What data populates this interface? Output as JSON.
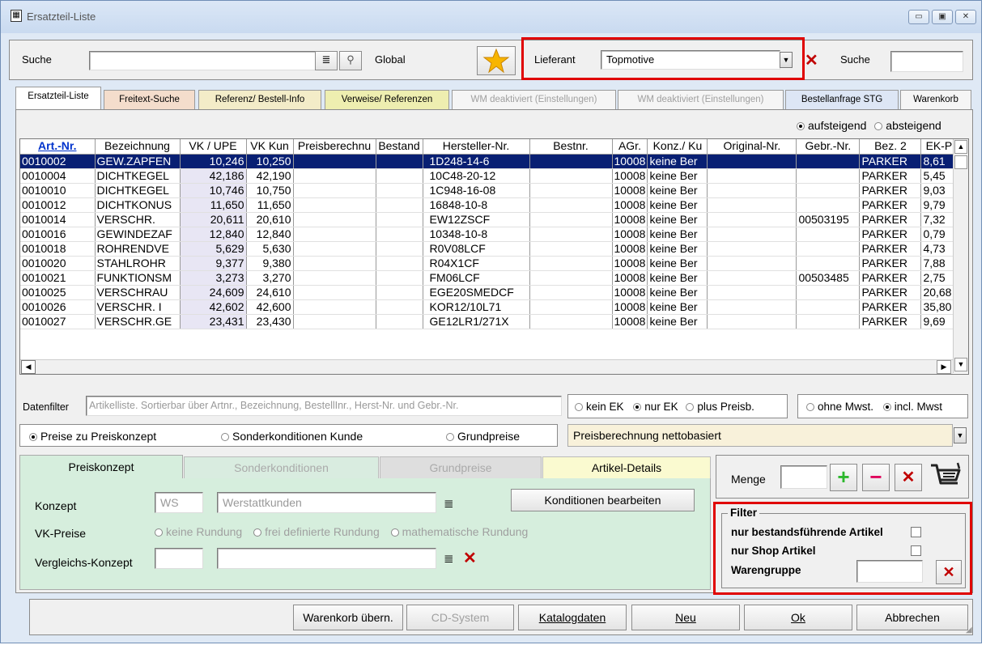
{
  "window": {
    "title": "Ersatzteil-Liste",
    "controls": {
      "minimize": "▭",
      "maximize": "▣",
      "close": "✕"
    }
  },
  "search": {
    "label": "Suche",
    "value": "",
    "scope": "Global",
    "supplier_label": "Lieferant",
    "supplier_value": "Topmotive",
    "search2_label": "Suche",
    "search2_value": ""
  },
  "tabs": [
    {
      "label": "Ersatzteil-Liste"
    },
    {
      "label": "Freitext-Suche"
    },
    {
      "label": "Referenz/ Bestell-Info"
    },
    {
      "label": "Verweise/ Referenzen"
    },
    {
      "label": "WM deaktiviert (Einstellungen)"
    },
    {
      "label": "WM deaktiviert (Einstellungen)"
    },
    {
      "label": "Bestellanfrage STG"
    },
    {
      "label": "Warenkorb"
    }
  ],
  "sort": {
    "asc": "aufsteigend",
    "desc": "absteigend"
  },
  "table": {
    "columns": [
      "Art.-Nr.",
      "Bezeichnung",
      "VK / UPE",
      "VK Kun",
      "Preisberechnu",
      "Bestand",
      "Hersteller-Nr.",
      "Bestnr.",
      "AGr.",
      "Konz./ Ku",
      "Original-Nr.",
      "Gebr.-Nr.",
      "Bez. 2",
      "EK-P"
    ],
    "rows": [
      [
        "0010002",
        "GEW.ZAPFEN",
        "10,246",
        "10,250",
        "",
        "",
        "1D248-14-6",
        "",
        "10008",
        "keine Ber",
        "",
        "",
        "PARKER",
        "8,61"
      ],
      [
        "0010004",
        "DICHTKEGEL",
        "42,186",
        "42,190",
        "",
        "",
        "10C48-20-12",
        "",
        "10008",
        "keine Ber",
        "",
        "",
        "PARKER",
        "5,45"
      ],
      [
        "0010010",
        "DICHTKEGEL",
        "10,746",
        "10,750",
        "",
        "",
        "1C948-16-08",
        "",
        "10008",
        "keine Ber",
        "",
        "",
        "PARKER",
        "9,03"
      ],
      [
        "0010012",
        "DICHTKONUS",
        "11,650",
        "11,650",
        "",
        "",
        "16848-10-8",
        "",
        "10008",
        "keine Ber",
        "",
        "",
        "PARKER",
        "9,79"
      ],
      [
        "0010014",
        "VERSCHR.",
        "20,611",
        "20,610",
        "",
        "",
        "EW12ZSCF",
        "",
        "10008",
        "keine Ber",
        "",
        "00503195",
        "PARKER",
        "7,32"
      ],
      [
        "0010016",
        "GEWINDEZAF",
        "12,840",
        "12,840",
        "",
        "",
        "10348-10-8",
        "",
        "10008",
        "keine Ber",
        "",
        "",
        "PARKER",
        "0,79"
      ],
      [
        "0010018",
        "ROHRENDVE",
        "5,629",
        "5,630",
        "",
        "",
        "R0V08LCF",
        "",
        "10008",
        "keine Ber",
        "",
        "",
        "PARKER",
        "4,73"
      ],
      [
        "0010020",
        "STAHLROHR",
        "9,377",
        "9,380",
        "",
        "",
        "R04X1CF",
        "",
        "10008",
        "keine Ber",
        "",
        "",
        "PARKER",
        "7,88"
      ],
      [
        "0010021",
        "FUNKTIONSM",
        "3,273",
        "3,270",
        "",
        "",
        "FM06LCF",
        "",
        "10008",
        "keine Ber",
        "",
        "00503485",
        "PARKER",
        "2,75"
      ],
      [
        "0010025",
        "VERSCHRAU",
        "24,609",
        "24,610",
        "",
        "",
        "EGE20SMEDCF",
        "",
        "10008",
        "keine Ber",
        "",
        "",
        "PARKER",
        "20,68"
      ],
      [
        "0010026",
        "VERSCHR.   I",
        "42,602",
        "42,600",
        "",
        "",
        "KOR12/10L71",
        "",
        "10008",
        "keine Ber",
        "",
        "",
        "PARKER",
        "35,80"
      ],
      [
        "0010027",
        "VERSCHR.GE",
        "23,431",
        "23,430",
        "",
        "",
        "GE12LR1/271X",
        "",
        "10008",
        "keine Ber",
        "",
        "",
        "PARKER",
        "9,69"
      ]
    ]
  },
  "datafilter": {
    "label": "Datenfilter",
    "placeholder": "Artikelliste. Sortierbar über Artnr., Bezeichnung, BestellInr., Herst-Nr. und Gebr.-Nr."
  },
  "ek_options": [
    "kein EK",
    "nur EK",
    "plus Preisb."
  ],
  "mwst_options": [
    "ohne Mwst.",
    "incl. Mwst"
  ],
  "price_options": [
    "Preise zu Preiskonzept",
    "Sonderkonditionen Kunde",
    "Grundpreise"
  ],
  "price_calc": "Preisberechnung nettobasiert",
  "subtabs": [
    "Preiskonzept",
    "Sonderkonditionen",
    "Grundpreise",
    "Artikel-Details"
  ],
  "konzept": {
    "label": "Konzept",
    "code": "WS",
    "name": "Werstattkunden",
    "edit_button": "Konditionen bearbeiten"
  },
  "vk": {
    "label": "VK-Preise",
    "options": [
      "keine Rundung",
      "frei definierte Rundung",
      "mathematische Rundung"
    ]
  },
  "vergleich": {
    "label": "Vergleichs-Konzept"
  },
  "menge": {
    "label": "Menge",
    "value": ""
  },
  "filter": {
    "title": "Filter",
    "bestand": "nur bestandsführende Artikel",
    "shop": "nur Shop Artikel",
    "warengruppe": "Warengruppe"
  },
  "buttons": [
    "Warenkorb übern.",
    "CD-System",
    "Katalogdaten",
    "Neu",
    "Ok",
    "Abbrechen"
  ],
  "colors": {
    "selection": "#081f73",
    "highlight_border": "#e00000",
    "panel_green": "#d6eedd",
    "add": "#2eb82e",
    "remove": "#e0005a"
  }
}
